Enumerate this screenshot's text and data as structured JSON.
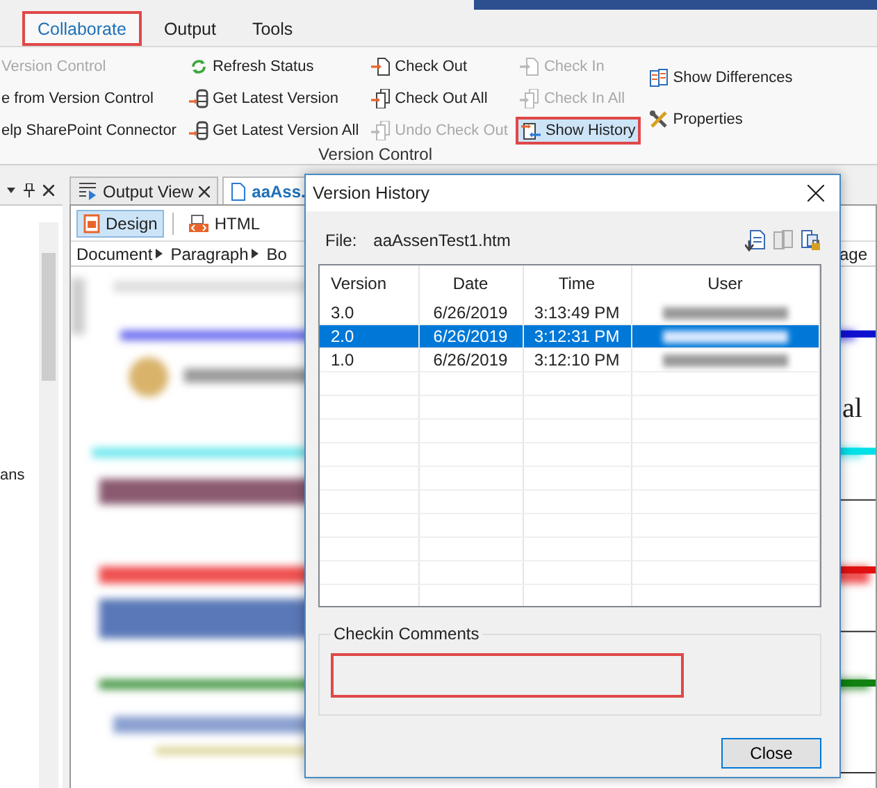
{
  "ribbon": {
    "tabs": [
      {
        "label": "Collaborate",
        "selected": true,
        "outlined": true
      },
      {
        "label": "Output",
        "selected": false,
        "outlined": false
      },
      {
        "label": "Tools",
        "selected": false,
        "outlined": false
      }
    ],
    "columns": [
      [
        {
          "label": "Version Control",
          "disabled": true,
          "selected": false,
          "outlined": false
        },
        {
          "label": "e from Version Control",
          "disabled": false,
          "selected": false,
          "outlined": false
        },
        {
          "label": "elp SharePoint Connector",
          "disabled": false,
          "selected": false,
          "outlined": false
        }
      ],
      [
        {
          "label": "Refresh Status",
          "disabled": false,
          "selected": false,
          "outlined": false
        },
        {
          "label": "Get Latest Version",
          "disabled": false,
          "selected": false,
          "outlined": false
        },
        {
          "label": "Get Latest Version All",
          "disabled": false,
          "selected": false,
          "outlined": false
        }
      ],
      [
        {
          "label": "Check Out",
          "disabled": false,
          "selected": false,
          "outlined": false
        },
        {
          "label": "Check Out All",
          "disabled": false,
          "selected": false,
          "outlined": false
        },
        {
          "label": "Undo Check Out",
          "disabled": true,
          "selected": false,
          "outlined": false
        }
      ],
      [
        {
          "label": "Check In",
          "disabled": true,
          "selected": false,
          "outlined": false
        },
        {
          "label": "Check In All",
          "disabled": true,
          "selected": false,
          "outlined": false
        },
        {
          "label": "Show History",
          "disabled": false,
          "selected": true,
          "outlined": true
        }
      ],
      [
        {
          "label": "Show Differences",
          "disabled": false,
          "selected": false,
          "outlined": false
        },
        {
          "label": "Properties",
          "disabled": false,
          "selected": false,
          "outlined": false
        }
      ]
    ],
    "group_label": "Version Control"
  },
  "left_pane": {
    "texts": [
      "ans"
    ]
  },
  "document": {
    "tabs": [
      {
        "label": "Output View",
        "selected": false,
        "closable": true
      },
      {
        "label": "aaAss.",
        "selected": true,
        "closable": false
      }
    ],
    "view_buttons": [
      {
        "label": "Design",
        "selected": true
      },
      {
        "label": "HTML",
        "selected": false
      }
    ],
    "breadcrumb": [
      {
        "label": "Document",
        "arrow": true
      },
      {
        "label": "Paragraph",
        "arrow": true
      },
      {
        "label": "Bo",
        "arrow": false
      },
      {
        "label": "age",
        "arrow": false
      }
    ],
    "visible_text": "al"
  },
  "dialog": {
    "title": "Version History",
    "file_label": "File:",
    "file_name": "aaAssenTest1.htm",
    "table": {
      "columns": [
        "Version",
        "Date",
        "Time",
        "User"
      ],
      "rows": [
        {
          "version": "3.0",
          "date": "6/26/2019",
          "time": "3:13:49 PM",
          "selected": false
        },
        {
          "version": "2.0",
          "date": "6/26/2019",
          "time": "3:12:31 PM",
          "selected": true
        },
        {
          "version": "1.0",
          "date": "6/26/2019",
          "time": "3:12:10 PM",
          "selected": false
        }
      ]
    },
    "comments": {
      "label": "Checkin Comments",
      "outlined": true
    },
    "close_button": "Close"
  }
}
